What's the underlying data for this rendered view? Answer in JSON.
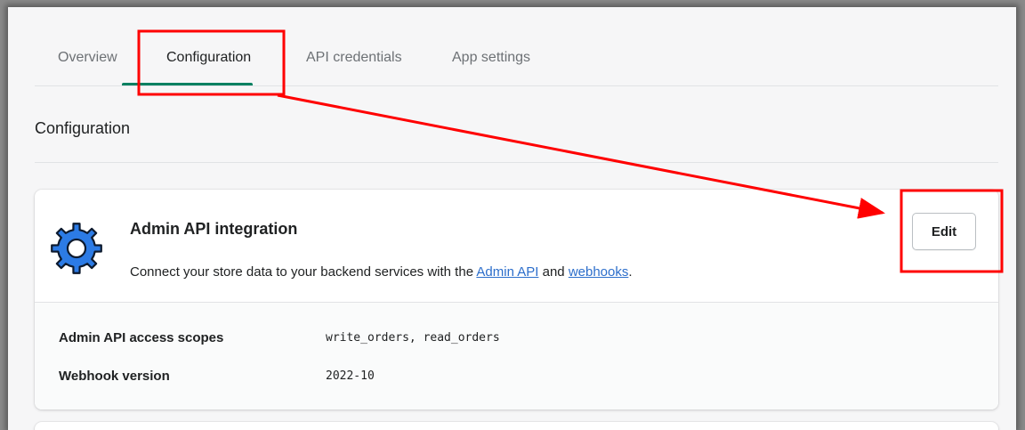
{
  "tabs": [
    {
      "label": "Overview",
      "active": false
    },
    {
      "label": "Configuration",
      "active": true
    },
    {
      "label": "API credentials",
      "active": false
    },
    {
      "label": "App settings",
      "active": false
    }
  ],
  "section": {
    "title": "Configuration"
  },
  "card": {
    "title": "Admin API integration",
    "description_before": "Connect your store data to your backend services with the ",
    "link_admin_api": "Admin API",
    "description_middle": " and ",
    "link_webhooks": "webhooks",
    "description_after": ".",
    "edit_label": "Edit",
    "icon": "gear-icon"
  },
  "details": [
    {
      "label": "Admin API access scopes",
      "value": "write_orders, read_orders"
    },
    {
      "label": "Webhook version",
      "value": "2022-10"
    }
  ],
  "colors": {
    "accent": "#008060",
    "link": "#2c6ecb",
    "annotation": "#ff0000",
    "gear": "#2c7be5"
  }
}
